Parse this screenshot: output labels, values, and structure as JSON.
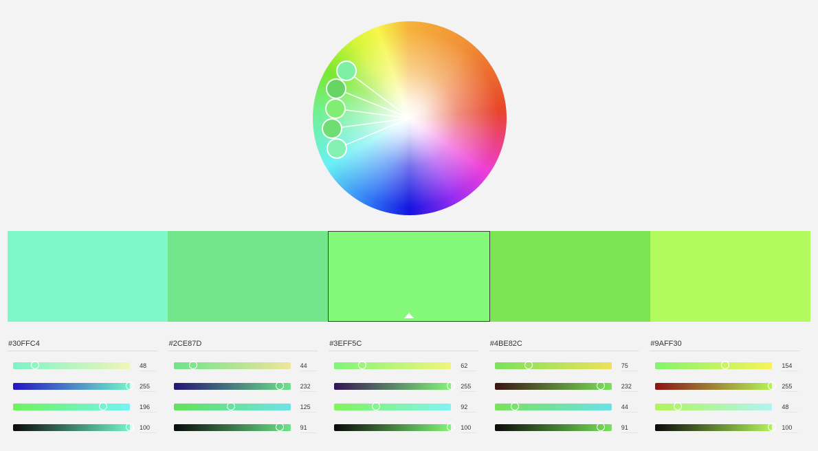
{
  "wheel": {
    "handles": [
      {
        "color": "#7ef0a6",
        "label": "handle-1"
      },
      {
        "color": "#67d563",
        "label": "handle-2"
      },
      {
        "color": "#7fee73",
        "label": "handle-3"
      },
      {
        "color": "#6fdc74",
        "label": "handle-4"
      },
      {
        "color": "#86f0b2",
        "label": "handle-5"
      }
    ]
  },
  "swatches": [
    {
      "hex": "#30FFC4",
      "fill": "#7ef8c8",
      "selected": false
    },
    {
      "hex": "#2CE87D",
      "fill": "#73e58a",
      "selected": false
    },
    {
      "hex": "#3EFF5C",
      "fill": "#84f878",
      "selected": true
    },
    {
      "hex": "#4BE82C",
      "fill": "#7de454",
      "selected": false
    },
    {
      "hex": "#9AFF30",
      "fill": "#b2fb5e",
      "selected": false
    }
  ],
  "columns": [
    {
      "hex": "#30FFC4",
      "sliders": [
        {
          "value": "48",
          "fraction": 0.19,
          "grad": [
            "#7cf3c8",
            "#f2f5b8"
          ]
        },
        {
          "value": "255",
          "fraction": 1.0,
          "grad": [
            "#2414c4",
            "#74f4c8"
          ]
        },
        {
          "value": "196",
          "fraction": 0.77,
          "grad": [
            "#6ef45a",
            "#74f4f4"
          ]
        },
        {
          "value": "100",
          "fraction": 1.0,
          "grad": [
            "#0a0a0a",
            "#74f4c8"
          ]
        }
      ]
    },
    {
      "hex": "#2CE87D",
      "sliders": [
        {
          "value": "44",
          "fraction": 0.17,
          "grad": [
            "#6ee38a",
            "#efe59c"
          ]
        },
        {
          "value": "232",
          "fraction": 0.91,
          "grad": [
            "#241474",
            "#6ee38a"
          ]
        },
        {
          "value": "125",
          "fraction": 0.49,
          "grad": [
            "#62e25a",
            "#6ee3e8"
          ]
        },
        {
          "value": "91",
          "fraction": 0.91,
          "grad": [
            "#0a0a0a",
            "#6ee38a"
          ]
        }
      ]
    },
    {
      "hex": "#3EFF5C",
      "sliders": [
        {
          "value": "62",
          "fraction": 0.24,
          "grad": [
            "#82f47a",
            "#f2f47a"
          ]
        },
        {
          "value": "255",
          "fraction": 1.0,
          "grad": [
            "#341454",
            "#82f47a"
          ]
        },
        {
          "value": "92",
          "fraction": 0.36,
          "grad": [
            "#82f45a",
            "#82f4f4"
          ]
        },
        {
          "value": "100",
          "fraction": 1.0,
          "grad": [
            "#0a0a0a",
            "#82f47a"
          ]
        }
      ]
    },
    {
      "hex": "#4BE82C",
      "sliders": [
        {
          "value": "75",
          "fraction": 0.29,
          "grad": [
            "#7ae25a",
            "#eee25a"
          ]
        },
        {
          "value": "232",
          "fraction": 0.91,
          "grad": [
            "#3a1414",
            "#7ae25a"
          ]
        },
        {
          "value": "44",
          "fraction": 0.17,
          "grad": [
            "#7ae25a",
            "#6ae2e8"
          ]
        },
        {
          "value": "91",
          "fraction": 0.91,
          "grad": [
            "#0a0a0a",
            "#7ae25a"
          ]
        }
      ]
    },
    {
      "hex": "#9AFF30",
      "sliders": [
        {
          "value": "154",
          "fraction": 0.6,
          "grad": [
            "#82f46a",
            "#f8f45a"
          ]
        },
        {
          "value": "255",
          "fraction": 1.0,
          "grad": [
            "#8a1414",
            "#b2f45a"
          ]
        },
        {
          "value": "48",
          "fraction": 0.19,
          "grad": [
            "#b2f45a",
            "#b2f4f4"
          ]
        },
        {
          "value": "100",
          "fraction": 1.0,
          "grad": [
            "#0a0a0a",
            "#b2f45a"
          ]
        }
      ]
    }
  ]
}
